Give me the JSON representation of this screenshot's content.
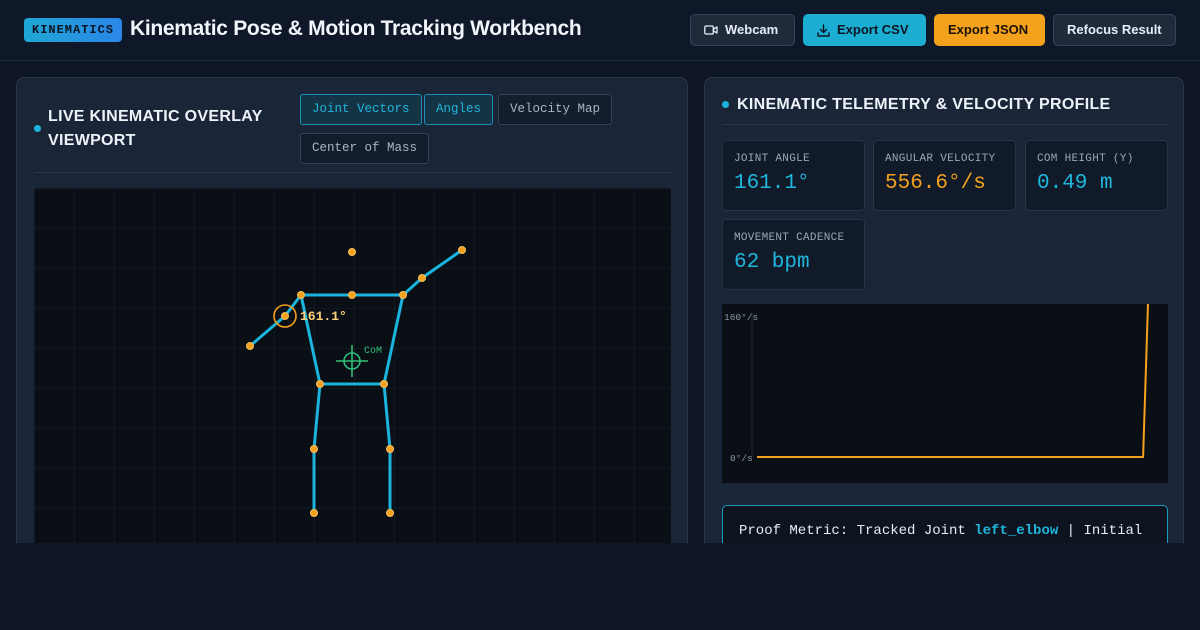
{
  "header": {
    "badge": "KINEMATICS",
    "title": "Kinematic Pose & Motion Tracking Workbench",
    "buttons": {
      "webcam": "Webcam",
      "export_csv": "Export CSV",
      "export_json": "Export JSON",
      "refocus": "Refocus Result"
    }
  },
  "viewport_panel": {
    "title_line1": "LIVE KINEMATIC OVERLAY",
    "title_line2": "VIEWPORT",
    "tabs": [
      {
        "label": "Joint Vectors",
        "active": true
      },
      {
        "label": "Angles",
        "active": true
      },
      {
        "label": "Velocity Map",
        "active": false
      },
      {
        "label": "Center of Mass",
        "active": false
      }
    ],
    "angle_label": "161.1°",
    "com_label": "CoM"
  },
  "telemetry_panel": {
    "title": "KINEMATIC TELEMETRY & VELOCITY PROFILE",
    "cards": [
      {
        "label": "JOINT ANGLE",
        "value": "161.1°",
        "color": "#1fb6dc"
      },
      {
        "label": "ANGULAR VELOCITY",
        "value": "556.6°/s",
        "color": "#f4a11d"
      },
      {
        "label": "COM HEIGHT (Y)",
        "value": "0.49 m",
        "color": "#1fb6dc"
      },
      {
        "label": "MOVEMENT CADENCE",
        "value": "62 bpm",
        "color": "#1fb6dc"
      }
    ],
    "proof": {
      "prefix": "Proof Metric: Tracked Joint ",
      "joint": "left_elbow",
      "suffix": " | Initial"
    }
  },
  "chart_data": {
    "type": "line",
    "title": "",
    "xlabel": "",
    "ylabel": "",
    "ytick_top": "160°/s",
    "ytick_bottom": "0°/s",
    "ylim": [
      0,
      160
    ],
    "series_color": "#f4a11d",
    "values": [
      0,
      0,
      0,
      0,
      0,
      0,
      0,
      0,
      0,
      0,
      0,
      0,
      0,
      0,
      0,
      0,
      0,
      0,
      0,
      0,
      0,
      0,
      0,
      0,
      0,
      0,
      0,
      0,
      0,
      0,
      0,
      0,
      0,
      0,
      0,
      0,
      0,
      0,
      0,
      0,
      0,
      0,
      0,
      0,
      0,
      0,
      0,
      0,
      0,
      0,
      0,
      0,
      0,
      0,
      0,
      0,
      0,
      0,
      0,
      0,
      0,
      0,
      0,
      0,
      0,
      0,
      0,
      0,
      0,
      0,
      0,
      0,
      0,
      0,
      0,
      0,
      0,
      0,
      0,
      556.6
    ]
  },
  "colors": {
    "accent": "#1fb6dc",
    "joint": "#f4a11d",
    "com": "#2fbf7a"
  }
}
